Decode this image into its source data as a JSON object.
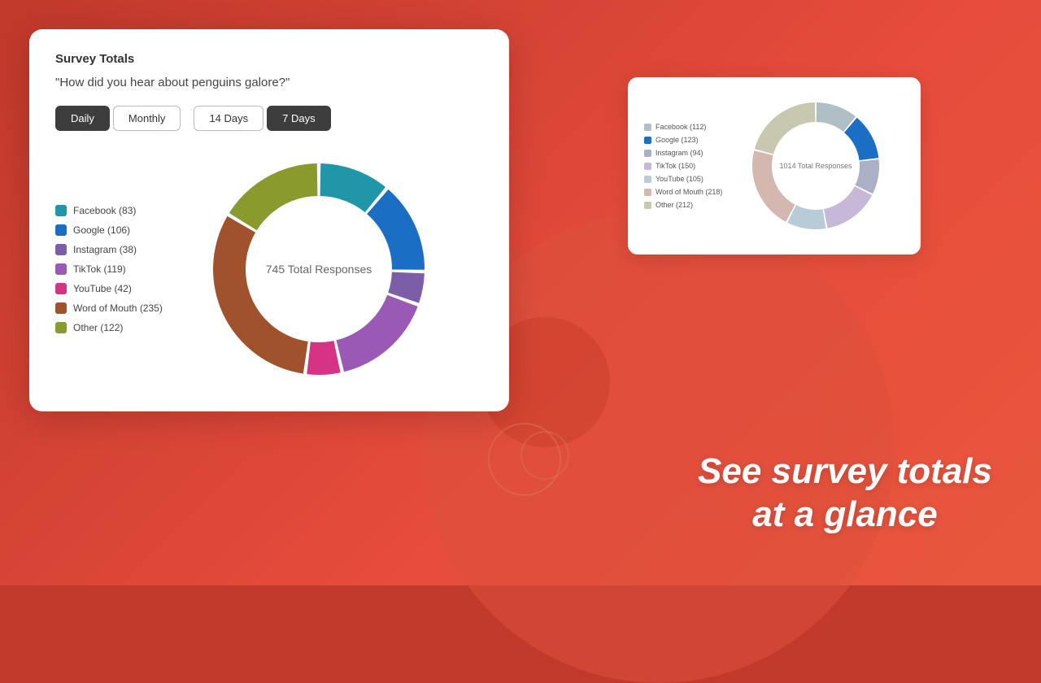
{
  "page": {
    "background_color": "#c0392b"
  },
  "main_card": {
    "title": "Survey Totals",
    "question": "\"How did you hear about penguins galore?\"",
    "buttons": {
      "daily": "Daily",
      "monthly": "Monthly",
      "fourteen_days": "14 Days",
      "seven_days": "7 Days"
    },
    "total_responses": "745 Total Responses",
    "legend": [
      {
        "label": "Facebook (83)",
        "color": "#2196a8"
      },
      {
        "label": "Google (106)",
        "color": "#1a6fc4"
      },
      {
        "label": "Instagram (38)",
        "color": "#7b5ea7"
      },
      {
        "label": "TikTok (119)",
        "color": "#9b59b6"
      },
      {
        "label": "YouTube (42)",
        "color": "#d63384"
      },
      {
        "label": "Word of Mouth (235)",
        "color": "#a0522d"
      },
      {
        "label": "Other (122)",
        "color": "#8a9a2d"
      }
    ]
  },
  "secondary_card": {
    "total_responses": "1014 Total Responses",
    "legend": [
      {
        "label": "Facebook (112)",
        "color": "#b0bec5"
      },
      {
        "label": "Google (123)",
        "color": "#1a6fc4"
      },
      {
        "label": "Instagram (94)",
        "color": "#aab0c5"
      },
      {
        "label": "TikTok (150)",
        "color": "#c8b8d8"
      },
      {
        "label": "YouTube (105)",
        "color": "#b8ccd8"
      },
      {
        "label": "Word of Mouth (218)",
        "color": "#d4b8b0"
      },
      {
        "label": "Other (212)",
        "color": "#c8c8b0"
      }
    ]
  },
  "tagline": {
    "line1": "See survey totals",
    "line2": "at a glance"
  },
  "donut": {
    "segments": [
      {
        "label": "Facebook",
        "value": 83,
        "color": "#2196a8",
        "pct": 11.14
      },
      {
        "label": "Google",
        "value": 106,
        "color": "#1a6fc4",
        "pct": 14.23
      },
      {
        "label": "Instagram",
        "value": 38,
        "color": "#7b5ea7",
        "pct": 5.1
      },
      {
        "label": "TikTok",
        "value": 119,
        "color": "#9b59b6",
        "pct": 15.97
      },
      {
        "label": "YouTube",
        "value": 42,
        "color": "#d63384",
        "pct": 5.64
      },
      {
        "label": "Word of Mouth",
        "value": 235,
        "color": "#a0522d",
        "pct": 31.54
      },
      {
        "label": "Other",
        "value": 122,
        "color": "#8a9a2d",
        "pct": 16.38
      }
    ],
    "gap_deg": 2
  },
  "secondary_donut": {
    "segments": [
      {
        "label": "Facebook",
        "value": 112,
        "color": "#b0bec5",
        "pct": 11.04
      },
      {
        "label": "Google",
        "value": 123,
        "color": "#1a6fc4",
        "pct": 12.13
      },
      {
        "label": "Instagram",
        "value": 94,
        "color": "#aab0c5",
        "pct": 9.27
      },
      {
        "label": "TikTok",
        "value": 150,
        "color": "#c8b8d8",
        "pct": 14.79
      },
      {
        "label": "YouTube",
        "value": 105,
        "color": "#b8ccd8",
        "pct": 10.35
      },
      {
        "label": "Word of Mouth",
        "value": 218,
        "color": "#d4b8b0",
        "pct": 21.5
      },
      {
        "label": "Other",
        "value": 212,
        "color": "#c8c8b0",
        "pct": 20.91
      }
    ]
  }
}
